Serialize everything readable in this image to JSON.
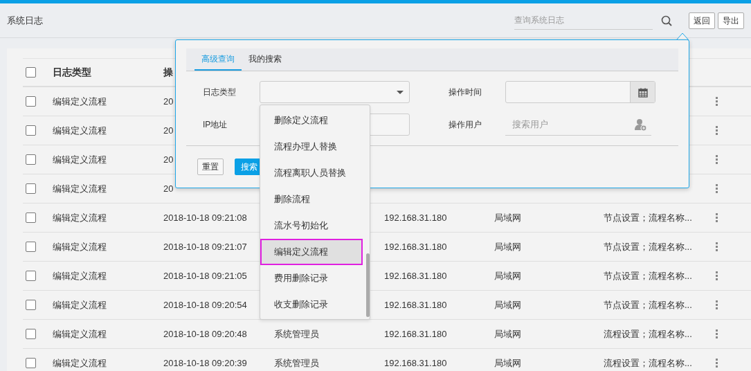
{
  "page": {
    "title": "系统日志",
    "search": {
      "placeholder": "查询系统日志"
    },
    "buttons": [
      "返回",
      "导出"
    ]
  },
  "table": {
    "select_all": {
      "checked": false
    },
    "columns": [
      "日志类型",
      "操"
    ],
    "rows": [
      {
        "checked": false,
        "type": "编辑定义流程",
        "time": "20"
      },
      {
        "checked": false,
        "type": "编辑定义流程",
        "time": "20"
      },
      {
        "checked": false,
        "type": "编辑定义流程",
        "time": "20"
      },
      {
        "checked": false,
        "type": "编辑定义流程",
        "time": "20"
      },
      {
        "checked": false,
        "type": "编辑定义流程",
        "time": "2018-10-18 09:21:08",
        "ip": "192.168.31.180",
        "network": "局域网",
        "details": "节点设置；流程名称..."
      },
      {
        "checked": false,
        "type": "编辑定义流程",
        "time": "2018-10-18 09:21:07",
        "ip": "192.168.31.180",
        "network": "局域网",
        "details": "节点设置；流程名称..."
      },
      {
        "checked": false,
        "type": "编辑定义流程",
        "time": "2018-10-18 09:21:05",
        "ip": "192.168.31.180",
        "network": "局域网",
        "details": "节点设置；流程名称..."
      },
      {
        "checked": false,
        "type": "编辑定义流程",
        "time": "2018-10-18 09:20:54",
        "ip": "192.168.31.180",
        "network": "局域网",
        "details": "节点设置；流程名称..."
      },
      {
        "checked": false,
        "type": "编辑定义流程",
        "time": "2018-10-18 09:20:48",
        "user": "系统管理员",
        "ip": "192.168.31.180",
        "network": "局域网",
        "details": "流程设置；流程名称..."
      },
      {
        "checked": false,
        "type": "编辑定义流程",
        "time": "2018-10-18 09:20:39",
        "user": "系统管理员",
        "ip": "192.168.31.180",
        "network": "局域网",
        "details": "流程设置；流程名称..."
      }
    ]
  },
  "search_popup": {
    "tabs": [
      {
        "label": "高级查询",
        "selected": true
      },
      {
        "label": "我的搜索",
        "selected": false
      }
    ],
    "fields": [
      {
        "label": "日志类型",
        "kind": "select"
      },
      {
        "label": "操作时间",
        "kind": "date"
      },
      {
        "label": "IP地址",
        "kind": "text"
      },
      {
        "label": "操作用户",
        "kind": "user",
        "placeholder": "搜索用户"
      }
    ],
    "buttons": [
      {
        "label": "重置",
        "kind": "default"
      },
      {
        "label": "搜索",
        "kind": "primary"
      }
    ],
    "dropdown": {
      "items": [
        {
          "label": "删除定义流程",
          "selected": false,
          "highlighted": false
        },
        {
          "label": "流程办理人替换",
          "selected": false,
          "highlighted": false
        },
        {
          "label": "流程离职人员替换",
          "selected": false,
          "highlighted": false
        },
        {
          "label": "删除流程",
          "selected": false,
          "highlighted": false
        },
        {
          "label": "流水号初始化",
          "selected": false,
          "highlighted": false
        },
        {
          "label": "编辑定义流程",
          "selected": true,
          "highlighted": true
        },
        {
          "label": "费用删除记录",
          "selected": false,
          "highlighted": false
        },
        {
          "label": "收支删除记录",
          "selected": false,
          "highlighted": false
        }
      ]
    }
  }
}
